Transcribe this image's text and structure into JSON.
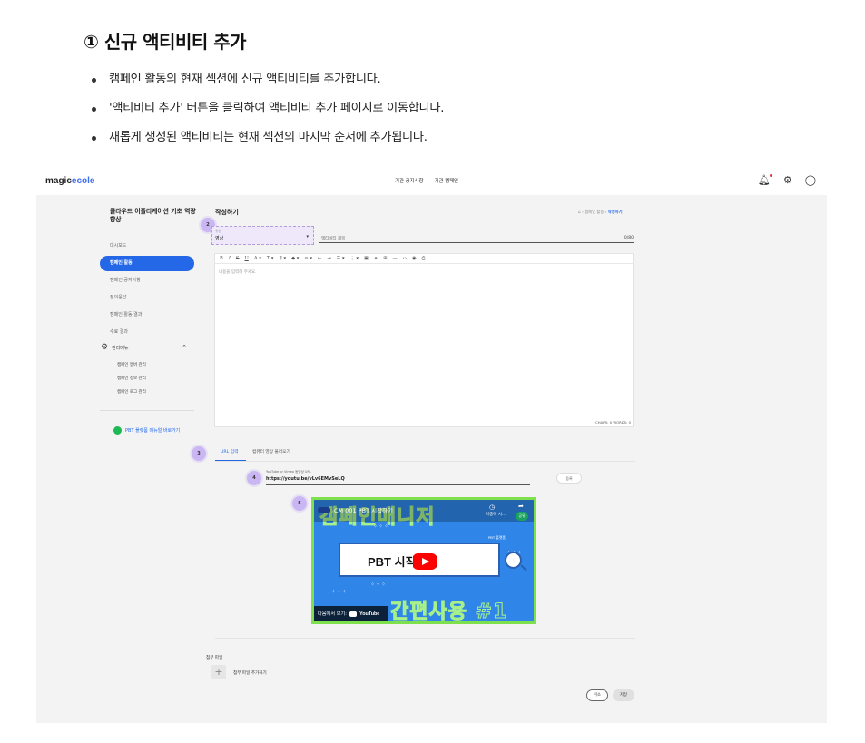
{
  "doc": {
    "title": "① 신규 액티비티 추가",
    "bullets": [
      "캠페인 활동의 현재 섹션에 신규 액티비티를 추가합니다.",
      "'액티비티 추가' 버튼을 클릭하여 액티비티 추가 페이지로 이동합니다.",
      "새롭게 생성된 액티비티는 현재 섹션의 마지막 순서에 추가됩니다."
    ]
  },
  "topbar": {
    "logo_main": "magic",
    "logo_accent": "ecole",
    "nav": [
      "기관 공지사항",
      "기관 캠페인"
    ],
    "icons": [
      "bell-icon",
      "settings-icon",
      "user-icon"
    ]
  },
  "sidebar": {
    "course_title": "클라우드 어플리케이션 기초 역량 향상",
    "items": [
      "대시보드",
      "캠페인 활동",
      "캠페인 공지사항",
      "질의응답",
      "캠페인 활동 결과",
      "수료 결과"
    ],
    "admin_label": "관리메뉴",
    "admin_items": [
      "캠페인 멤버 관리",
      "캠페인 정보 관리",
      "캠페인 로그 관리"
    ],
    "link_label": "PBT 플랫폼 매뉴얼 바로가기"
  },
  "main": {
    "title": "작성하기",
    "breadcrumb": [
      "캠페인 활동",
      "작성하기"
    ],
    "type_label": "유형",
    "type_value": "영상",
    "title_placeholder": "액티비티 제목",
    "title_count": "0/80",
    "editor_placeholder": "내용을 입력해 주세요.",
    "editor_count": "CHARS: 0   WORDS: 0",
    "tabs": [
      "URL 입력",
      "컴퓨터 영상 불러오기"
    ],
    "url_label": "YouTube or Vimeo 동영상 URL",
    "url_value": "https://youtu.be/vLv6EMvSeLQ",
    "register_label": "등록",
    "attach_label": "첨부 파일",
    "attach_add_label": "첨부 파일 추가하기",
    "cancel_label": "취소",
    "save_label": "저장"
  },
  "badges": [
    "2",
    "3",
    "4",
    "5"
  ],
  "video": {
    "title": "CM 001 PBT 시작하기",
    "banner": "PBT 시작하기",
    "later": "나중에 시...",
    "share": "공유",
    "tag": "PBT 플랫폼",
    "bg_top": "캠페인매니저",
    "bg_bottom": "간편사용 #1",
    "watch_label": "다음에서 보기:",
    "watch_brand": "YouTube"
  },
  "colors": {
    "accent": "#2468e8",
    "badge": "#c9b6f2",
    "video_bg": "#2f86e8",
    "video_border": "#7ee04d"
  }
}
